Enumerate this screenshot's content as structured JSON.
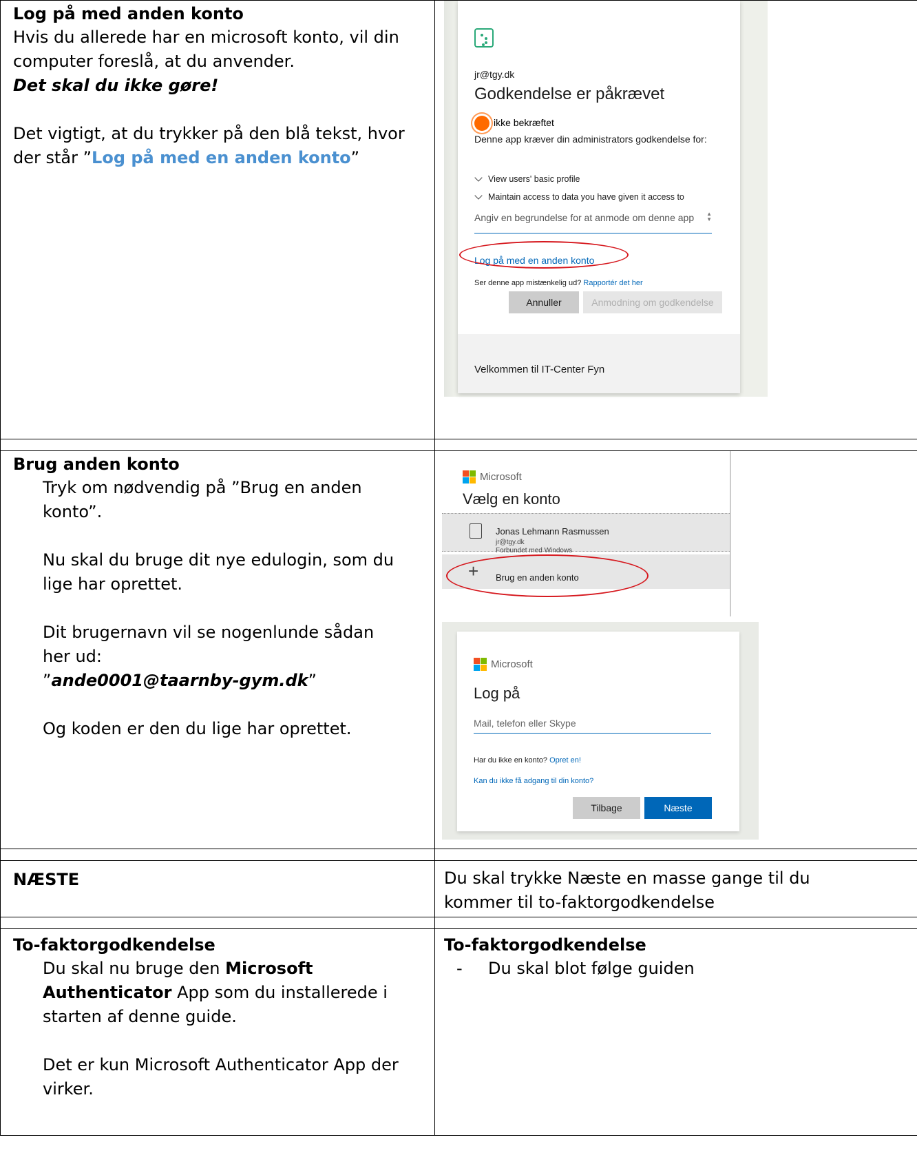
{
  "section1": {
    "heading": "Log på med anden konto",
    "line1": "Hvis du allerede har en microsoft konto, vil din computer foreslå, at du anvender.",
    "warning": "Det skal du ikke gøre!",
    "line2_pre": "Det vigtigt, at du trykker på den blå tekst, hvor der står ”",
    "line2_link": "Log på med en anden konto",
    "line2_post": "”",
    "screenshot": {
      "email": "jr@tgy.dk",
      "title": "Godkendelse er påkrævet",
      "status": "ikke bekræftet",
      "description": "Denne app kræver din administrators godkendelse for:",
      "permissions": [
        "View users' basic profile",
        "Maintain access to data you have given it access to"
      ],
      "textarea_placeholder": "Angiv en begrundelse for at anmode om denne app",
      "other_account_link": "Log på med en anden konto",
      "suspicious_text": "Ser denne app mistænkelig ud?",
      "report_link": "Rapportér det her",
      "cancel_button": "Annuller",
      "request_button": "Anmodning om godkendelse",
      "footer": "Velkommen til IT-Center Fyn"
    }
  },
  "section2": {
    "heading": "Brug anden konto",
    "p1": "Tryk om nødvendig på ”Brug en anden konto”.",
    "p2": "Nu skal du bruge dit nye edulogin, som du lige har oprettet.",
    "p3": "Dit brugernavn vil se nogenlunde sådan her ud:",
    "p3_quote_open": "”",
    "p3_example": "ande0001@taarnby-gym.dk",
    "p3_quote_close": "”",
    "p4": "Og koden er den du lige har oprettet.",
    "pick_account": {
      "brand": "Microsoft",
      "title": "Vælg en konto",
      "account_name": "Jonas Lehmann Rasmussen",
      "account_email": "jr@tgy.dk",
      "account_status": "Forbundet med Windows",
      "other_account": "Brug en anden konto"
    },
    "sign_in": {
      "brand": "Microsoft",
      "title": "Log på",
      "input_placeholder": "Mail, telefon eller Skype",
      "no_account": "Har du ikke en konto?",
      "create_link": "Opret en!",
      "no_access_link": "Kan du ikke få adgang til din konto?",
      "back_button": "Tilbage",
      "next_button": "Næste"
    }
  },
  "section3": {
    "heading": "NÆSTE",
    "text": "Du skal trykke Næste en masse gange til du kommer til to-faktorgodkendelse"
  },
  "section4": {
    "heading": "To-faktorgodkendelse",
    "p1_pre": "Du skal nu bruge den ",
    "p1_bold": "Microsoft Authenticator",
    "p1_post": " App som du installerede i starten af denne guide.",
    "p2": "Det er kun Microsoft Authenticator App der virker.",
    "right_heading": "To-faktorgodkendelse",
    "dash": "-",
    "right_item": "Du skal blot følge guiden"
  }
}
